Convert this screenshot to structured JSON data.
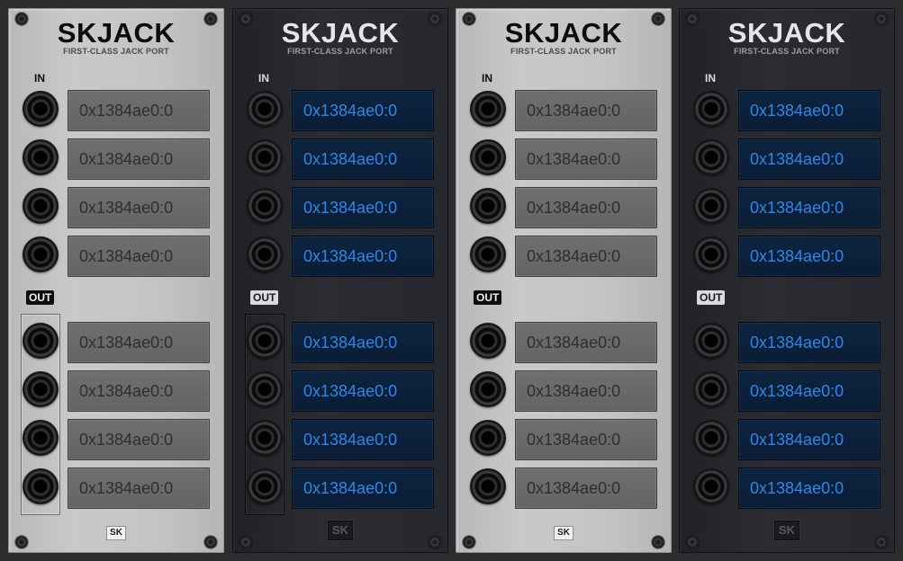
{
  "modules": [
    {
      "theme": "light",
      "title": "SKJACK",
      "subtitle": "FIRST-CLASS JACK PORT",
      "in_label": "IN",
      "out_label": "OUT",
      "inputs": [
        "0x1384ae0:0",
        "0x1384ae0:0",
        "0x1384ae0:0",
        "0x1384ae0:0"
      ],
      "outputs": [
        "0x1384ae0:0",
        "0x1384ae0:0",
        "0x1384ae0:0",
        "0x1384ae0:0"
      ],
      "logo": "SK"
    },
    {
      "theme": "dark",
      "title": "SKJACK",
      "subtitle": "FIRST-CLASS JACK PORT",
      "in_label": "IN",
      "out_label": "OUT",
      "inputs": [
        "0x1384ae0:0",
        "0x1384ae0:0",
        "0x1384ae0:0",
        "0x1384ae0:0"
      ],
      "outputs": [
        "0x1384ae0:0",
        "0x1384ae0:0",
        "0x1384ae0:0",
        "0x1384ae0:0"
      ],
      "logo": "SK"
    },
    {
      "theme": "light",
      "title": "SKJACK",
      "subtitle": "FIRST-CLASS JACK PORT",
      "in_label": "IN",
      "out_label": "OUT",
      "inputs": [
        "0x1384ae0:0",
        "0x1384ae0:0",
        "0x1384ae0:0",
        "0x1384ae0:0"
      ],
      "outputs": [
        "0x1384ae0:0",
        "0x1384ae0:0",
        "0x1384ae0:0",
        "0x1384ae0:0"
      ],
      "logo": "SK"
    },
    {
      "theme": "dark",
      "title": "SKJACK",
      "subtitle": "FIRST-CLASS JACK PORT",
      "in_label": "IN",
      "out_label": "OUT",
      "inputs": [
        "0x1384ae0:0",
        "0x1384ae0:0",
        "0x1384ae0:0",
        "0x1384ae0:0"
      ],
      "outputs": [
        "0x1384ae0:0",
        "0x1384ae0:0",
        "0x1384ae0:0",
        "0x1384ae0:0"
      ],
      "logo": "SK"
    }
  ],
  "colors": {
    "light_panel": "#c3c4c6",
    "dark_panel": "#26282d",
    "light_field": "#666769",
    "dark_field": "#0b1f38",
    "dark_field_text": "#2f86e8"
  }
}
